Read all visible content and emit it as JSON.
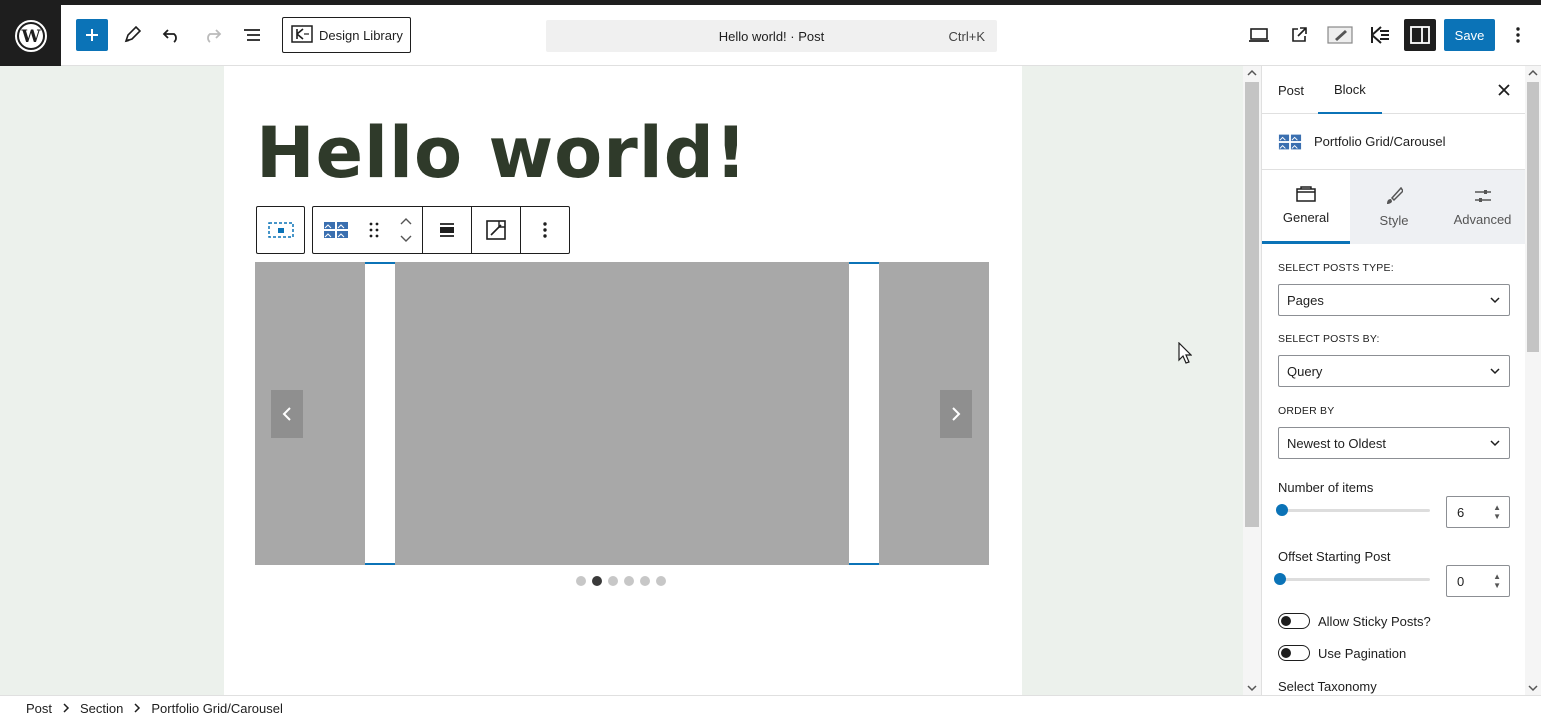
{
  "topbar": {
    "design_library_label": "Design Library",
    "command_title": "Hello world! · Post",
    "command_shortcut": "Ctrl+K",
    "save_label": "Save"
  },
  "editor": {
    "post_title": "Hello world!",
    "carousel_dots": 6,
    "carousel_active_dot": 1
  },
  "sidebar": {
    "tabs": [
      {
        "label": "Post"
      },
      {
        "label": "Block"
      }
    ],
    "block_name": "Portfolio Grid/Carousel",
    "inner_tabs": [
      {
        "label": "General",
        "icon": "general-icon"
      },
      {
        "label": "Style",
        "icon": "brush-icon"
      },
      {
        "label": "Advanced",
        "icon": "sliders-icon"
      }
    ],
    "select_posts_type_label": "SELECT POSTS TYPE:",
    "select_posts_type_value": "Pages",
    "select_posts_by_label": "SELECT POSTS BY:",
    "select_posts_by_value": "Query",
    "order_by_label": "ORDER BY",
    "order_by_value": "Newest to Oldest",
    "number_of_items_label": "Number of items",
    "number_of_items_value": "6",
    "offset_label": "Offset Starting Post",
    "offset_value": "0",
    "sticky_label": "Allow Sticky Posts?",
    "pagination_label": "Use Pagination",
    "taxonomy_label": "Select Taxonomy"
  },
  "breadcrumb": {
    "items": [
      "Post",
      "Section",
      "Portfolio Grid/Carousel"
    ]
  },
  "colors": {
    "accent": "#0b73b7",
    "dark": "#1e1e1e",
    "canvas_bg": "#ecf1ec",
    "title_color": "#2f3a2a"
  }
}
